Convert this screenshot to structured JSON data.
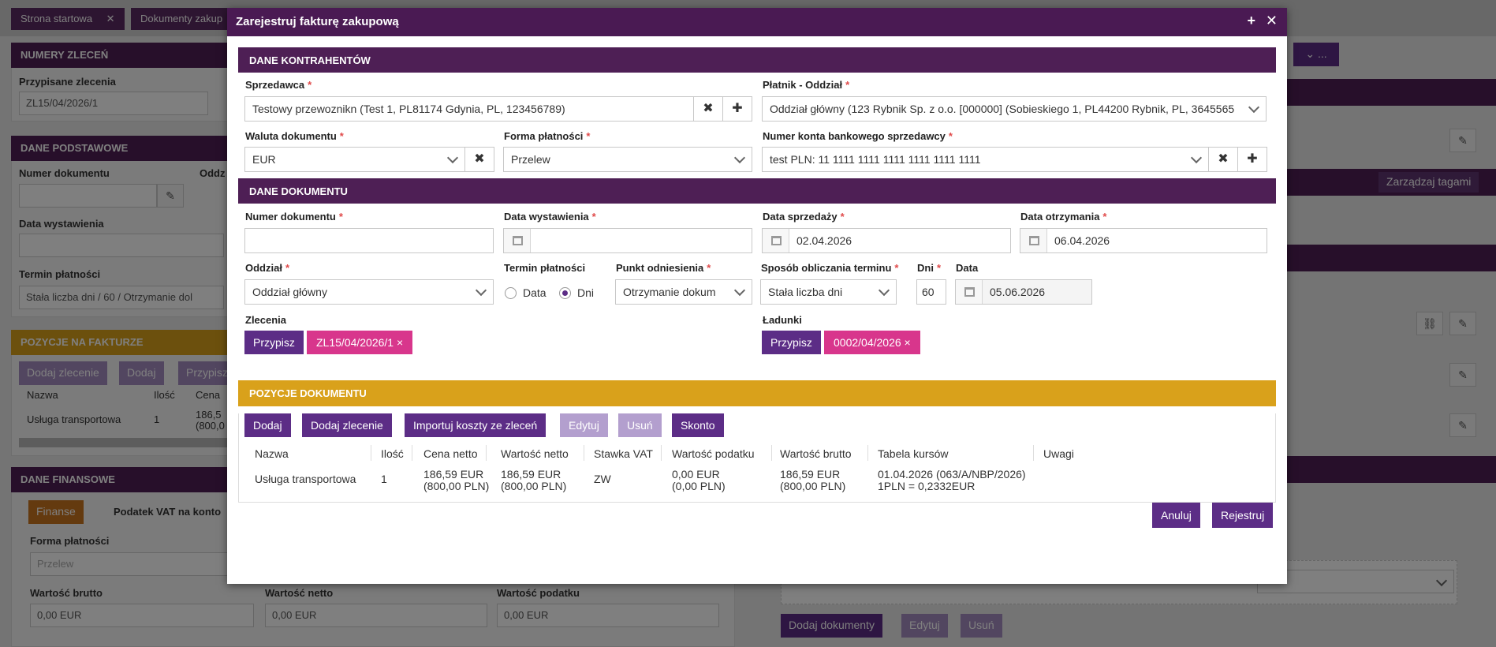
{
  "background": {
    "tabs": [
      "Strona startowa",
      "Dokumenty zakup"
    ],
    "numery_zlecen": {
      "header": "NUMERY ZLECEŃ",
      "label": "Przypisane zlecenia",
      "value": "ZL15/04/2026/1"
    },
    "dane_podstawowe": {
      "header": "DANE PODSTAWOWE",
      "numer_dokumentu": "Numer dokumentu",
      "oddzial": "Oddz",
      "data_wystawienia": "Data wystawienia",
      "termin_platnosci": "Termin płatności",
      "termin_value": "Stała liczba dni / 60 / Otrzymanie dol"
    },
    "pozycje": {
      "header": "POZYCJE NA FAKTURZE",
      "buttons": [
        "Dodaj zlecenie",
        "Dodaj",
        "Przypisz"
      ],
      "cols": [
        "Nazwa",
        "Ilość",
        "Cena"
      ],
      "row": [
        "Usługa transportowa",
        "1",
        "186,5",
        "(800,0"
      ]
    },
    "dane_finansowe": {
      "header": "DANE FINANSOWE",
      "tabs": [
        "Finanse",
        "Podatek VAT na konto"
      ],
      "forma_label": "Forma płatności",
      "forma_value": "Przelew",
      "brutto_label": "Wartość brutto",
      "brutto_value": "0,00 EUR",
      "netto_label": "Wartość netto",
      "netto_value": "0,00 EUR",
      "podatek_label": "Wartość podatku",
      "podatek_value": "0,00 EUR"
    },
    "right": {
      "tag_button": "Zarządzaj tagami",
      "doc_buttons": [
        "Dodaj dokumenty",
        "Edytuj",
        "Usuń"
      ],
      "dots": "..."
    }
  },
  "modal": {
    "title": "Zarejestruj fakturę zakupową",
    "title_icons": [
      "+",
      "✕"
    ],
    "sections": {
      "kontrahenci": "DANE KONTRAHENTÓW",
      "dokument": "DANE DOKUMENTU",
      "pozycje": "POZYCJE DOKUMENTU"
    },
    "sprzedawca": {
      "label": "Sprzedawca",
      "value": "Testowy przewoznikn (Test 1, PL81174 Gdynia, PL, 123456789)"
    },
    "platnik": {
      "label": "Płatnik - Oddział",
      "value": "Oddział główny (123 Rybnik Sp. z o.o. [000000] (Sobieskiego 1, PL44200 Rybnik, PL, 3645565"
    },
    "waluta": {
      "label": "Waluta dokumentu",
      "value": "EUR"
    },
    "forma": {
      "label": "Forma płatności",
      "value": "Przelew"
    },
    "konto": {
      "label": "Numer konta bankowego sprzedawcy",
      "value": "test PLN: 11 1111 1111 1111 1111 1111 1111"
    },
    "numer_dokumentu": {
      "label": "Numer dokumentu",
      "value": ""
    },
    "data_wystawienia": {
      "label": "Data wystawienia",
      "value": ""
    },
    "data_sprzedazy": {
      "label": "Data sprzedaży",
      "value": "02.04.2026"
    },
    "data_otrzymania": {
      "label": "Data otrzymania",
      "value": "06.04.2026"
    },
    "oddzial": {
      "label": "Oddział",
      "value": "Oddział główny"
    },
    "termin": {
      "label": "Termin płatności",
      "options": [
        "Data",
        "Dni"
      ],
      "selected": "Dni"
    },
    "punkt": {
      "label": "Punkt odniesienia",
      "value": "Otrzymanie dokum"
    },
    "sposob": {
      "label": "Sposób obliczania terminu",
      "value": "Stała liczba dni"
    },
    "dni": {
      "label": "Dni",
      "value": "60"
    },
    "data": {
      "label": "Data",
      "value": "05.06.2026"
    },
    "zlecenia": {
      "label": "Zlecenia",
      "button": "Przypisz",
      "tag": "ZL15/04/2026/1 ×"
    },
    "ladunki": {
      "label": "Ładunki",
      "button": "Przypisz",
      "tag": "0002/04/2026 ×"
    },
    "items_buttons": [
      "Dodaj",
      "Dodaj zlecenie",
      "Importuj koszty ze zleceń",
      "Edytuj",
      "Usuń",
      "Skonto"
    ],
    "columns": [
      "Nazwa",
      "Ilość",
      "Cena netto",
      "Wartość netto",
      "Stawka VAT",
      "Wartość podatku",
      "Wartość brutto",
      "Tabela kursów",
      "Uwagi"
    ],
    "row": {
      "nazwa": "Usługa transportowa",
      "ilosc": "1",
      "cena_netto": [
        "186,59 EUR",
        "(800,00 PLN)"
      ],
      "wartosc_netto": [
        "186,59 EUR",
        "(800,00 PLN)"
      ],
      "stawka": "ZW",
      "wartosc_podatku": [
        "0,00 EUR",
        "(0,00 PLN)"
      ],
      "wartosc_brutto": [
        "186,59 EUR",
        "(800,00 PLN)"
      ],
      "tabela": [
        "01.04.2026 (063/A/NBP/2026)",
        "1PLN = 0,2332EUR"
      ],
      "uwagi": ""
    },
    "footer": {
      "cancel": "Anuluj",
      "submit": "Rejestruj"
    }
  }
}
